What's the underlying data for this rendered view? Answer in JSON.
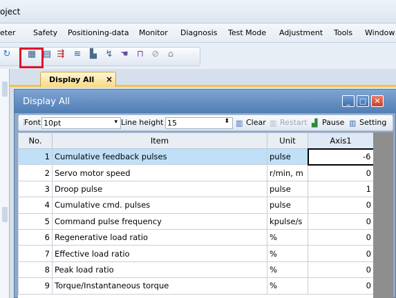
{
  "window": {
    "title_fragment": "oject"
  },
  "menu": [
    "eter",
    "Safety",
    "Positioning-data",
    "Monitor",
    "Diagnosis",
    "Test Mode",
    "Adjustment",
    "Tools",
    "Window"
  ],
  "toolbar_icons": [
    "refresh-icon",
    "display-all-icon",
    "batch-display-icon",
    "io-monitor-icon",
    "graph-icon",
    "alarm-display-icon",
    "test-operation-icon",
    "hand-icon",
    "machine-analyzer-icon",
    "tuning-icon",
    "setting-icon"
  ],
  "tab": {
    "label": "Display All",
    "close": "×"
  },
  "inner": {
    "title": "Display All",
    "buttons": {
      "minimize": "_",
      "maximize": "□",
      "close": "✕"
    },
    "toolbar": {
      "font_label": "Font",
      "font_value": "10pt",
      "line_height_label": "Line height",
      "line_height_value": "15",
      "clear_label": "Clear",
      "restart_label": "Restart",
      "pause_label": "Pause",
      "setting_label": "Setting"
    }
  },
  "table": {
    "headers": {
      "no": "No.",
      "item": "Item",
      "unit": "Unit",
      "axis": "Axis1"
    },
    "rows": [
      {
        "no": "1",
        "item": "Cumulative feedback pulses",
        "unit": "pulse",
        "value": "-6"
      },
      {
        "no": "2",
        "item": "Servo motor speed",
        "unit": "r/min, m",
        "value": "0"
      },
      {
        "no": "3",
        "item": "Droop pulse",
        "unit": "pulse",
        "value": "1"
      },
      {
        "no": "4",
        "item": "Cumulative cmd. pulses",
        "unit": "pulse",
        "value": "0"
      },
      {
        "no": "5",
        "item": "Command pulse frequency",
        "unit": "kpulse/s",
        "value": "0"
      },
      {
        "no": "6",
        "item": "Regenerative load ratio",
        "unit": "%",
        "value": "0"
      },
      {
        "no": "7",
        "item": "Effective load ratio",
        "unit": "%",
        "value": "0"
      },
      {
        "no": "8",
        "item": "Peak load ratio",
        "unit": "%",
        "value": "0"
      },
      {
        "no": "9",
        "item": "Torque/Instantaneous torque",
        "unit": "%",
        "value": "0"
      }
    ]
  },
  "colors": {
    "highlight": "#e0142b",
    "selected_row": "#bfe0f7",
    "tab_accent": "#f2c34a",
    "inner_title": "#4f7db5"
  }
}
